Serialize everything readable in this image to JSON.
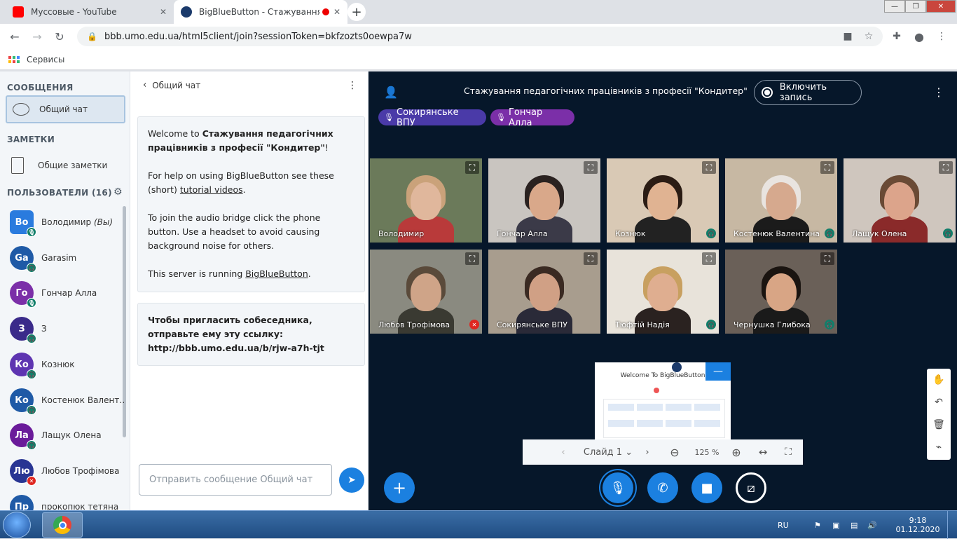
{
  "browser": {
    "tabs": [
      {
        "title": "Муссовые - YouTube",
        "favicon_color": "#ff0000"
      },
      {
        "title": "BigBlueButton - Стажування",
        "favicon_color": "#1b3a6b"
      }
    ],
    "url": "bbb.umo.edu.ua/html5client/join?sessionToken=bkfzozts0oewpa7w",
    "bookmark": "Сервисы"
  },
  "sidebar": {
    "messages_heading": "СООБЩЕНИЯ",
    "public_chat": "Общий чат",
    "notes_heading": "ЗАМЕТКИ",
    "shared_notes": "Общие заметки",
    "users_heading": "ПОЛЬЗОВАТЕЛИ (16)",
    "users": [
      {
        "initials": "Во",
        "name": "Володимир",
        "suffix": "(Вы)",
        "color": "#2a7bde",
        "status": "audio"
      },
      {
        "initials": "Ga",
        "name": "Garasim",
        "color": "#1f5aa6",
        "status": "audio"
      },
      {
        "initials": "Го",
        "name": "Гончар Алла",
        "color": "#7b2fa8",
        "status": "audio"
      },
      {
        "initials": "З",
        "name": "З",
        "color": "#3a2a8a",
        "status": "audio"
      },
      {
        "initials": "Ко",
        "name": "کознюк",
        "color": "#5e35b1",
        "status": "audio"
      },
      {
        "initials": "Ко",
        "name": "Костенюк Валент…",
        "color": "#1f5aa6",
        "status": "audio"
      },
      {
        "initials": "Ла",
        "name": "Лащук Олена",
        "color": "#6a1b9a",
        "status": "audio"
      },
      {
        "initials": "Лю",
        "name": "Любов Трофімова",
        "color": "#283593",
        "status": "muted"
      },
      {
        "initials": "Пр",
        "name": "прокопюк тетяна",
        "color": "#1f5aa6",
        "status": "audio"
      }
    ]
  },
  "chat": {
    "title": "Общий чат",
    "welcome": {
      "line1_prefix": "Welcome to ",
      "line1_bold": "Стажування педагогічних працівників з професії \"Кондитер\"",
      "line1_suffix": "!",
      "help_prefix": "For help on using BigBlueButton see these (short) ",
      "help_link": "tutorial videos",
      "help_suffix": ".",
      "audio": "To join the audio bridge click the phone button. Use a headset to avoid causing background noise for others.",
      "server_prefix": "This server is running ",
      "server_link": "BigBlueButton",
      "server_suffix": "."
    },
    "invite": {
      "text": "Чтобы пригласить собеседника, отправьте ему эту ссылку:",
      "link": "http://bbb.umo.edu.ua/b/rjw-a7h-tjt"
    },
    "input_placeholder": "Отправить сообщение Общий чат"
  },
  "main": {
    "meeting_title": "Стажування педагогічних працівників з професії \"Кондитер\"",
    "record_label": "Включить запись",
    "talkers": [
      {
        "name": "Сокирянське ВПУ",
        "color": "#4a3aa8"
      },
      {
        "name": "Гончар Алла",
        "color": "#7b2fa8"
      }
    ],
    "videos": [
      {
        "name": "Володимир",
        "bg": "#6b7a5a",
        "skin": "#e0b79c",
        "hair": "#caa27a",
        "body": "#b93a3a",
        "status": ""
      },
      {
        "name": "Гончар Алла",
        "bg": "#c9c5c0",
        "skin": "#d9a88a",
        "hair": "#2a2220",
        "body": "#3b3a48",
        "status": ""
      },
      {
        "name": "Кознюк",
        "bg": "#d9c9b5",
        "skin": "#e0b392",
        "hair": "#2b1c14",
        "body": "#222",
        "status": "audio"
      },
      {
        "name": "Костенюк Валентина",
        "bg": "#c7b8a3",
        "skin": "#d6a98e",
        "hair": "#e9e4e0",
        "body": "#1b1b1b",
        "status": "audio"
      },
      {
        "name": "Лащук Олена",
        "bg": "#cfc6be",
        "skin": "#dca48b",
        "hair": "#6a4a35",
        "body": "#8a2a2a",
        "status": "audio"
      },
      {
        "name": "Любов Трофімова",
        "bg": "#8a8a80",
        "skin": "#cfa488",
        "hair": "#5a4a3a",
        "body": "#3a3a32",
        "status": "muted"
      },
      {
        "name": "Сокирянське ВПУ",
        "bg": "#a89d8e",
        "skin": "#d0a085",
        "hair": "#3a2a22",
        "body": "#2a2a38",
        "status": ""
      },
      {
        "name": "Тюфтій Надія",
        "bg": "#e8e3da",
        "skin": "#dfae90",
        "hair": "#c8a060",
        "body": "#2a2220",
        "status": "audio"
      },
      {
        "name": "Чернушка Глибока",
        "bg": "#6a6058",
        "skin": "#d8a585",
        "hair": "#1a1410",
        "body": "#1a1a1a",
        "status": "audio"
      }
    ],
    "slide": {
      "title": "Welcome To BigBlueButton",
      "label": "Слайд 1",
      "zoom": "125 %"
    }
  },
  "taskbar": {
    "lang": "RU",
    "time": "9:18",
    "date": "01.12.2020"
  }
}
